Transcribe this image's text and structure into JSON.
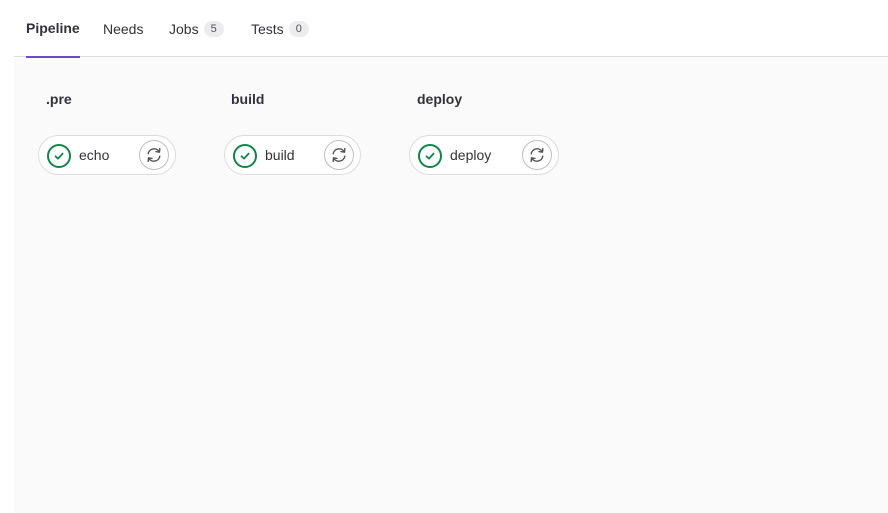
{
  "tabs": [
    {
      "label": "Pipeline"
    },
    {
      "label": "Needs"
    },
    {
      "label": "Jobs",
      "count": "5"
    },
    {
      "label": "Tests",
      "count": "0"
    }
  ],
  "stages": [
    {
      "title": ".pre",
      "job": {
        "name": "echo",
        "status": "passed"
      }
    },
    {
      "title": "build",
      "job": {
        "name": "build",
        "status": "passed"
      }
    },
    {
      "title": "deploy",
      "job": {
        "name": "deploy",
        "status": "passed"
      }
    }
  ],
  "icons": {
    "status": "check-circle-icon",
    "retry": "retry-icon"
  },
  "colors": {
    "success": "#108548",
    "tab_active": "#6e49cb"
  }
}
